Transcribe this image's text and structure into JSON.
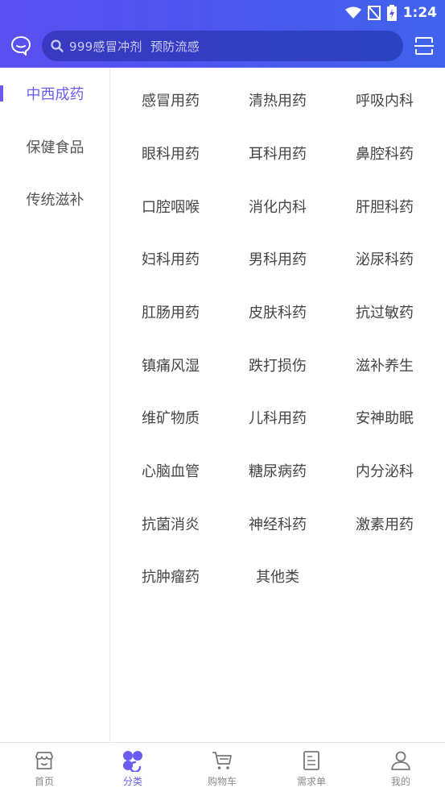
{
  "status_bar": {
    "time": "1:24"
  },
  "header": {
    "search_placeholder": "999感冒冲剂  预防流感",
    "accent_color": "#6b5cf0"
  },
  "sidebar": {
    "items": [
      {
        "label": "中西成药",
        "active": true
      },
      {
        "label": "保健食品",
        "active": false
      },
      {
        "label": "传统滋补",
        "active": false
      }
    ]
  },
  "categories": [
    "感冒用药",
    "清热用药",
    "呼吸内科",
    "眼科用药",
    "耳科用药",
    "鼻腔科药",
    "口腔咽喉",
    "消化内科",
    "肝胆科药",
    "妇科用药",
    "男科用药",
    "泌尿科药",
    "肛肠用药",
    "皮肤科药",
    "抗过敏药",
    "镇痛风湿",
    "跌打损伤",
    "滋补养生",
    "维矿物质",
    "儿科用药",
    "安神助眠",
    "心脑血管",
    "糖尿病药",
    "内分泌科",
    "抗菌消炎",
    "神经科药",
    "激素用药",
    "抗肿瘤药",
    "其他类"
  ],
  "tabbar": {
    "items": [
      {
        "label": "首页",
        "icon": "store-icon",
        "active": false
      },
      {
        "label": "分类",
        "icon": "category-icon",
        "active": true
      },
      {
        "label": "购物车",
        "icon": "cart-icon",
        "active": false
      },
      {
        "label": "需求单",
        "icon": "list-icon",
        "active": false
      },
      {
        "label": "我的",
        "icon": "user-icon",
        "active": false
      }
    ]
  }
}
